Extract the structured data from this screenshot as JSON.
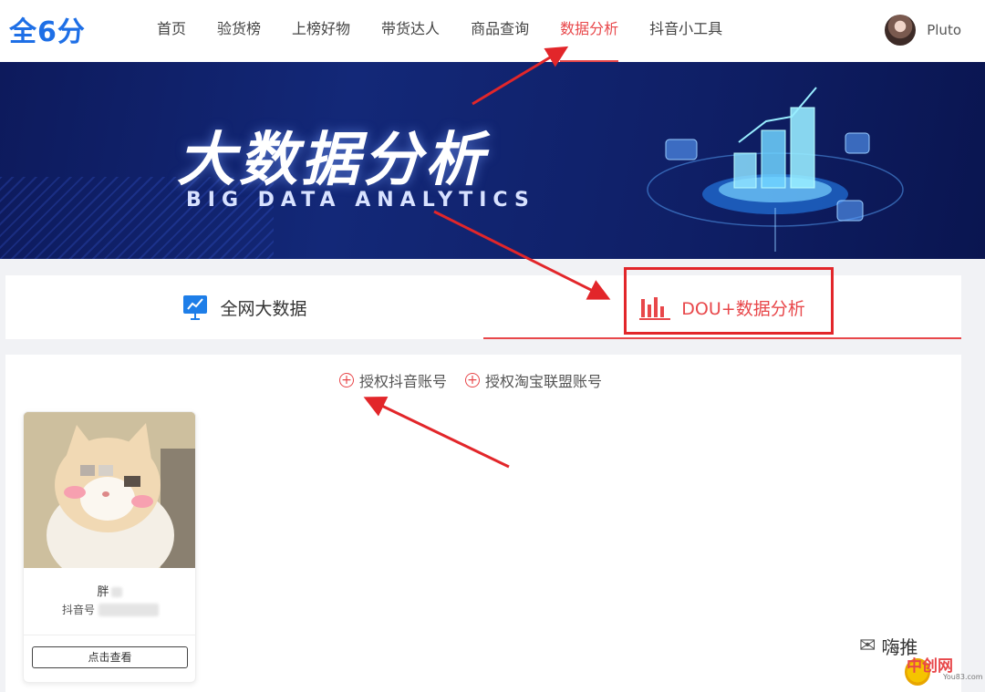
{
  "header": {
    "logo": "全6分",
    "nav": [
      {
        "label": "首页",
        "active": false
      },
      {
        "label": "验货榜",
        "active": false
      },
      {
        "label": "上榜好物",
        "active": false
      },
      {
        "label": "带货达人",
        "active": false
      },
      {
        "label": "商品查询",
        "active": false
      },
      {
        "label": "数据分析",
        "active": true
      },
      {
        "label": "抖音小工具",
        "active": false
      }
    ],
    "user": {
      "name": "Pluto"
    }
  },
  "banner": {
    "title": "大数据分析",
    "subtitle": "BIG DATA ANALYTICS"
  },
  "tabs": [
    {
      "label": "全网大数据",
      "icon": "presentation-chart-icon",
      "active": false
    },
    {
      "label": "DOU+数据分析",
      "icon": "bar-chart-icon",
      "active": true
    }
  ],
  "auth_links": [
    {
      "label": "授权抖音账号",
      "icon": "plus-circle-icon"
    },
    {
      "label": "授权淘宝联盟账号",
      "icon": "plus-circle-icon"
    }
  ],
  "account_card": {
    "name": "胖",
    "id_label": "抖音号",
    "button_label": "点击查看"
  },
  "watermarks": {
    "wechat": "嗨推",
    "site": "中创网",
    "site_url": "You83.com"
  },
  "colors": {
    "accent": "#e8474a",
    "brand_blue": "#1e6fe6",
    "banner_bg": "#132878",
    "annotation_red": "#e2262a"
  }
}
